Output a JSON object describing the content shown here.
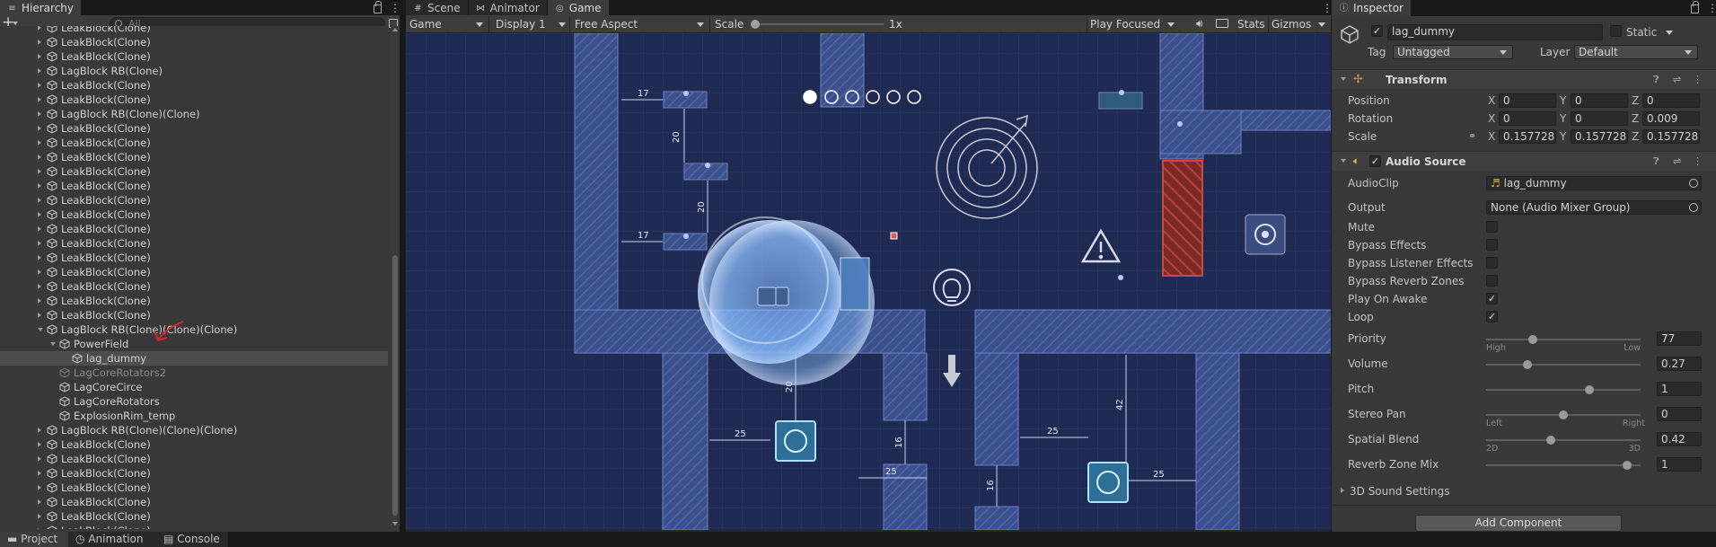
{
  "hierarchy": {
    "tab_label": "Hierarchy",
    "search_placeholder": "All",
    "add_label": "+",
    "rows": [
      {
        "label": "LeakBlock(Clone)",
        "indent": 1,
        "fold": "closed",
        "state": "normal"
      },
      {
        "label": "LeakBlock(Clone)",
        "indent": 1,
        "fold": "closed",
        "state": "normal"
      },
      {
        "label": "LeakBlock(Clone)",
        "indent": 1,
        "fold": "closed",
        "state": "normal"
      },
      {
        "label": "LagBlock RB(Clone)",
        "indent": 1,
        "fold": "closed",
        "state": "normal"
      },
      {
        "label": "LeakBlock(Clone)",
        "indent": 1,
        "fold": "closed",
        "state": "normal"
      },
      {
        "label": "LeakBlock(Clone)",
        "indent": 1,
        "fold": "closed",
        "state": "normal"
      },
      {
        "label": "LagBlock RB(Clone)(Clone)",
        "indent": 1,
        "fold": "closed",
        "state": "normal"
      },
      {
        "label": "LeakBlock(Clone)",
        "indent": 1,
        "fold": "closed",
        "state": "normal"
      },
      {
        "label": "LeakBlock(Clone)",
        "indent": 1,
        "fold": "closed",
        "state": "normal"
      },
      {
        "label": "LeakBlock(Clone)",
        "indent": 1,
        "fold": "closed",
        "state": "normal"
      },
      {
        "label": "LeakBlock(Clone)",
        "indent": 1,
        "fold": "closed",
        "state": "normal"
      },
      {
        "label": "LeakBlock(Clone)",
        "indent": 1,
        "fold": "closed",
        "state": "normal"
      },
      {
        "label": "LeakBlock(Clone)",
        "indent": 1,
        "fold": "closed",
        "state": "normal"
      },
      {
        "label": "LeakBlock(Clone)",
        "indent": 1,
        "fold": "closed",
        "state": "normal"
      },
      {
        "label": "LeakBlock(Clone)",
        "indent": 1,
        "fold": "closed",
        "state": "normal"
      },
      {
        "label": "LeakBlock(Clone)",
        "indent": 1,
        "fold": "closed",
        "state": "normal"
      },
      {
        "label": "LeakBlock(Clone)",
        "indent": 1,
        "fold": "closed",
        "state": "normal"
      },
      {
        "label": "LeakBlock(Clone)",
        "indent": 1,
        "fold": "closed",
        "state": "normal"
      },
      {
        "label": "LeakBlock(Clone)",
        "indent": 1,
        "fold": "closed",
        "state": "normal"
      },
      {
        "label": "LeakBlock(Clone)",
        "indent": 1,
        "fold": "closed",
        "state": "normal"
      },
      {
        "label": "LeakBlock(Clone)",
        "indent": 1,
        "fold": "closed",
        "state": "normal"
      },
      {
        "label": "LagBlock RB(Clone)(Clone)(Clone)",
        "indent": 1,
        "fold": "open",
        "state": "normal"
      },
      {
        "label": "PowerField",
        "indent": 2,
        "fold": "open",
        "state": "normal"
      },
      {
        "label": "lag_dummy",
        "indent": 3,
        "fold": "none",
        "state": "selected"
      },
      {
        "label": "LagCoreRotators2",
        "indent": 2,
        "fold": "none",
        "state": "dim"
      },
      {
        "label": "LagCoreCirce",
        "indent": 2,
        "fold": "none",
        "state": "normal"
      },
      {
        "label": "LagCoreRotators",
        "indent": 2,
        "fold": "none",
        "state": "normal"
      },
      {
        "label": "ExplosionRim_temp",
        "indent": 2,
        "fold": "none",
        "state": "normal"
      },
      {
        "label": "LagBlock RB(Clone)(Clone)(Clone)",
        "indent": 1,
        "fold": "closed",
        "state": "normal"
      },
      {
        "label": "LeakBlock(Clone)",
        "indent": 1,
        "fold": "closed",
        "state": "normal"
      },
      {
        "label": "LeakBlock(Clone)",
        "indent": 1,
        "fold": "closed",
        "state": "normal"
      },
      {
        "label": "LeakBlock(Clone)",
        "indent": 1,
        "fold": "closed",
        "state": "normal"
      },
      {
        "label": "LeakBlock(Clone)",
        "indent": 1,
        "fold": "closed",
        "state": "normal"
      },
      {
        "label": "LeakBlock(Clone)",
        "indent": 1,
        "fold": "closed",
        "state": "normal"
      },
      {
        "label": "LeakBlock(Clone)",
        "indent": 1,
        "fold": "closed",
        "state": "normal"
      },
      {
        "label": "LeakBlock(Clone)",
        "indent": 1,
        "fold": "closed",
        "state": "normal"
      }
    ]
  },
  "center": {
    "tabs": [
      {
        "label": "Scene",
        "icon": "hash-icon"
      },
      {
        "label": "Animator",
        "icon": "animator-icon"
      },
      {
        "label": "Game",
        "icon": "gamepad-icon"
      }
    ],
    "toolbar": {
      "display_mode": "Game",
      "display": "Display 1",
      "aspect": "Free Aspect",
      "scale_label": "Scale",
      "scale_value": "1x",
      "play_mode": "Play Focused",
      "stats_label": "Stats",
      "gizmos_label": "Gizmos"
    },
    "game": {
      "dimension_labels": [
        "17",
        "20",
        "20",
        "17",
        "20",
        "25",
        "16",
        "25",
        "25",
        "42",
        "16",
        "25"
      ],
      "progress_dots": {
        "filled": 1,
        "total": 6
      }
    }
  },
  "inspector": {
    "tab_label": "Inspector",
    "object_name": "lag_dummy",
    "static_label": "Static",
    "tag_label": "Tag",
    "tag_value": "Untagged",
    "layer_label": "Layer",
    "layer_value": "Default",
    "transform": {
      "title": "Transform",
      "rows": [
        {
          "label": "Position",
          "x": "0",
          "y": "0",
          "z": "0"
        },
        {
          "label": "Rotation",
          "x": "0",
          "y": "0",
          "z": "0.009"
        },
        {
          "label": "Scale",
          "x": "0.1577287",
          "y": "0.1577287",
          "z": "0.1577287"
        }
      ]
    },
    "audio": {
      "title": "Audio Source",
      "audioclip_label": "AudioClip",
      "audioclip_value": "lag_dummy",
      "output_label": "Output",
      "output_value": "None (Audio Mixer Group)",
      "toggles": [
        {
          "label": "Mute",
          "checked": false
        },
        {
          "label": "Bypass Effects",
          "checked": false
        },
        {
          "label": "Bypass Listener Effects",
          "checked": false
        },
        {
          "label": "Bypass Reverb Zones",
          "checked": false
        },
        {
          "label": "Play On Awake",
          "checked": true
        },
        {
          "label": "Loop",
          "checked": true
        }
      ],
      "sliders": [
        {
          "label": "Priority",
          "value": "77",
          "fraction": 0.3,
          "min_label": "High",
          "max_label": "Low"
        },
        {
          "label": "Volume",
          "value": "0.27",
          "fraction": 0.27,
          "min_label": "",
          "max_label": ""
        },
        {
          "label": "Pitch",
          "value": "1",
          "fraction": 0.67,
          "min_label": "",
          "max_label": ""
        },
        {
          "label": "Stereo Pan",
          "value": "0",
          "fraction": 0.5,
          "min_label": "Left",
          "max_label": "Right"
        },
        {
          "label": "Spatial Blend",
          "value": "0.42",
          "fraction": 0.42,
          "min_label": "2D",
          "max_label": "3D"
        },
        {
          "label": "Reverb Zone Mix",
          "value": "1",
          "fraction": 0.91,
          "min_label": "",
          "max_label": ""
        }
      ],
      "sound_settings_label": "3D Sound Settings"
    },
    "add_component_label": "Add Component"
  },
  "bottom_tabs": [
    {
      "label": "Project",
      "icon": "folder-icon"
    },
    {
      "label": "Animation",
      "icon": "animation-icon"
    },
    {
      "label": "Console",
      "icon": "console-icon"
    }
  ]
}
